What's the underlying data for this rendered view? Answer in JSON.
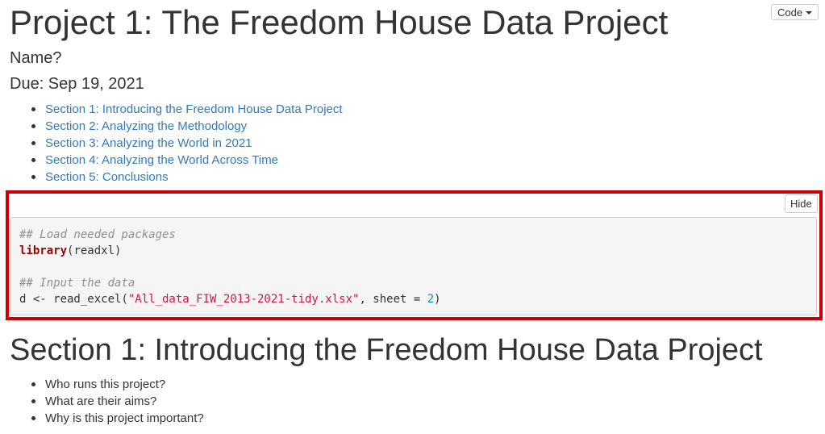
{
  "header": {
    "title": "Project 1: The Freedom House Data Project",
    "author": "Name?",
    "date": "Due: Sep 19, 2021",
    "code_button_label": "Code"
  },
  "toc": {
    "items": [
      {
        "label": "Section 1: Introducing the Freedom House Data Project"
      },
      {
        "label": "Section 2: Analyzing the Methodology"
      },
      {
        "label": "Section 3: Analyzing the World in 2021"
      },
      {
        "label": "Section 4: Analyzing the World Across Time"
      },
      {
        "label": "Section 5: Conclusions"
      }
    ]
  },
  "code_chunk": {
    "hide_label": "Hide",
    "comment1": "## Load needed packages",
    "line2_fn": "library",
    "line2_rest": "(readxl)",
    "comment2": "## Input the data",
    "line5_pre": "d <- read_excel(",
    "line5_str": "\"All_data_FIW_2013-2021-tidy.xlsx\"",
    "line5_mid": ", sheet = ",
    "line5_num": "2",
    "line5_end": ")"
  },
  "section1": {
    "heading": "Section 1: Introducing the Freedom House Data Project",
    "questions": [
      "Who runs this project?",
      "What are their aims?",
      "Why is this project important?"
    ]
  },
  "colors": {
    "link": "#337ab7",
    "highlight_border": "#cc0000",
    "code_background": "#f5f5f5"
  }
}
